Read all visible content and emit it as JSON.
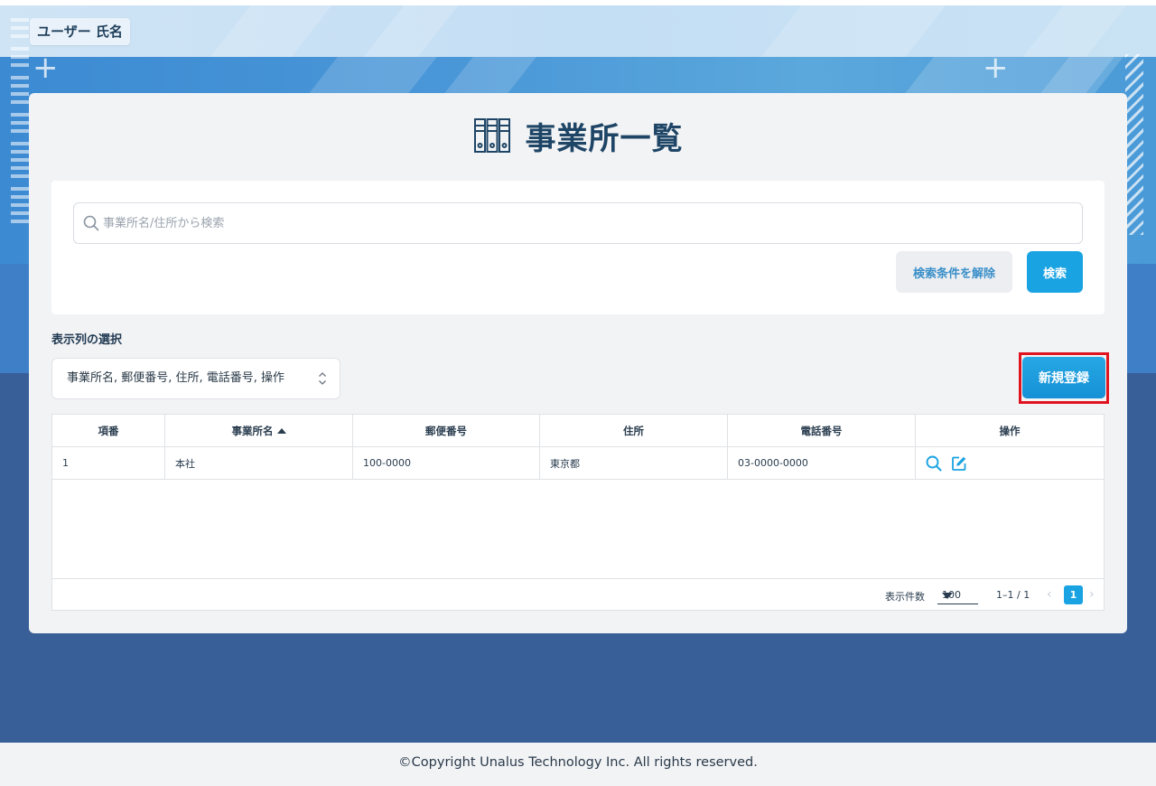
{
  "header": {
    "user_name": "ユーザー 氏名"
  },
  "page": {
    "title": "事業所一覧",
    "title_icon": "binders-icon"
  },
  "search": {
    "placeholder": "事業所名/住所から検索",
    "value": "",
    "clear_label": "検索条件を解除",
    "search_label": "検索"
  },
  "columns_selector": {
    "label": "表示列の選択",
    "value": "事業所名, 郵便番号, 住所, 電話番号, 操作"
  },
  "actions": {
    "new_label": "新規登録"
  },
  "table": {
    "headers": [
      "項番",
      "事業所名",
      "郵便番号",
      "住所",
      "電話番号",
      "操作"
    ],
    "sort_column": "事業所名",
    "sort_direction": "asc",
    "rows": [
      {
        "no": "1",
        "name": "本社",
        "postal": "100-0000",
        "address": "東京都",
        "phone": "03-0000-0000",
        "ops": [
          "search-icon",
          "edit-icon"
        ]
      }
    ]
  },
  "pagination": {
    "per_page_label": "表示件数",
    "per_page": "100",
    "range": "1–1 / 1",
    "current_page": "1"
  },
  "footer": {
    "copyright": "©Copyright Unalus Technology Inc. All rights reserved."
  },
  "colors": {
    "accent": "#1aa3e2",
    "highlight_border": "#e0141e",
    "title": "#1e4566"
  }
}
